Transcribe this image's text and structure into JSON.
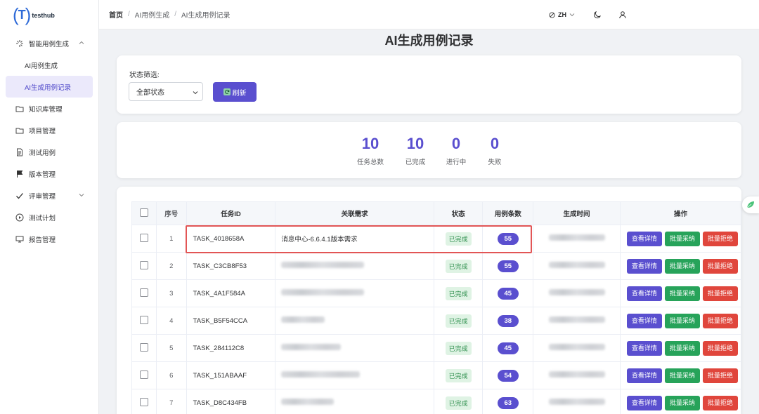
{
  "app": {
    "logo_text": "testhub",
    "logo_mark_left": "(",
    "logo_mark_mid": "T",
    "logo_mark_right": ")"
  },
  "sidebar": {
    "items": [
      {
        "label": "智能用例生成",
        "icon": "sparkle-icon",
        "expanded": true,
        "children": [
          {
            "label": "AI用例生成"
          },
          {
            "label": "AI生成用例记录",
            "active": true
          }
        ]
      },
      {
        "label": "知识库管理",
        "icon": "folder-icon"
      },
      {
        "label": "项目管理",
        "icon": "folder-icon"
      },
      {
        "label": "测试用例",
        "icon": "document-icon"
      },
      {
        "label": "版本管理",
        "icon": "flag-icon"
      },
      {
        "label": "评审管理",
        "icon": "check-icon",
        "expandable": true
      },
      {
        "label": "测试计划",
        "icon": "play-circle-icon"
      },
      {
        "label": "报告管理",
        "icon": "report-icon"
      }
    ]
  },
  "topbar": {
    "breadcrumb": [
      "首页",
      "AI用例生成",
      "AI生成用例记录"
    ],
    "lang": "ZH"
  },
  "page": {
    "title": "AI生成用例记录"
  },
  "filter": {
    "label": "状态筛选:",
    "select_value": "全部状态",
    "refresh_label": "刷新"
  },
  "stats": [
    {
      "value": "10",
      "label": "任务总数"
    },
    {
      "value": "10",
      "label": "已完成"
    },
    {
      "value": "0",
      "label": "进行中"
    },
    {
      "value": "0",
      "label": "失败"
    }
  ],
  "table": {
    "headers": [
      "序号",
      "任务ID",
      "关联需求",
      "状态",
      "用例条数",
      "生成时间",
      "操作"
    ],
    "actions": [
      "查看详情",
      "批量采纳",
      "批量拒绝"
    ],
    "rows": [
      {
        "no": "1",
        "task_id": "TASK_4018658A",
        "requirement": "消息中心-6.6.4.1版本需求",
        "status": "已完成",
        "count": "55"
      },
      {
        "no": "2",
        "task_id": "TASK_C3CB8F53",
        "requirement": "",
        "status": "已完成",
        "count": "55"
      },
      {
        "no": "3",
        "task_id": "TASK_4A1F584A",
        "requirement": "",
        "status": "已完成",
        "count": "45"
      },
      {
        "no": "4",
        "task_id": "TASK_B5F54CCA",
        "requirement": "",
        "status": "已完成",
        "count": "38"
      },
      {
        "no": "5",
        "task_id": "TASK_284112C8",
        "requirement": "",
        "status": "已完成",
        "count": "45"
      },
      {
        "no": "6",
        "task_id": "TASK_151ABAAF",
        "requirement": "",
        "status": "已完成",
        "count": "54"
      },
      {
        "no": "7",
        "task_id": "TASK_D8C434FB",
        "requirement": "",
        "status": "已完成",
        "count": "63"
      }
    ]
  },
  "colors": {
    "accent": "#5a4fcf",
    "success": "#27a35a",
    "danger": "#e0463c",
    "highlight": "#e25555"
  }
}
